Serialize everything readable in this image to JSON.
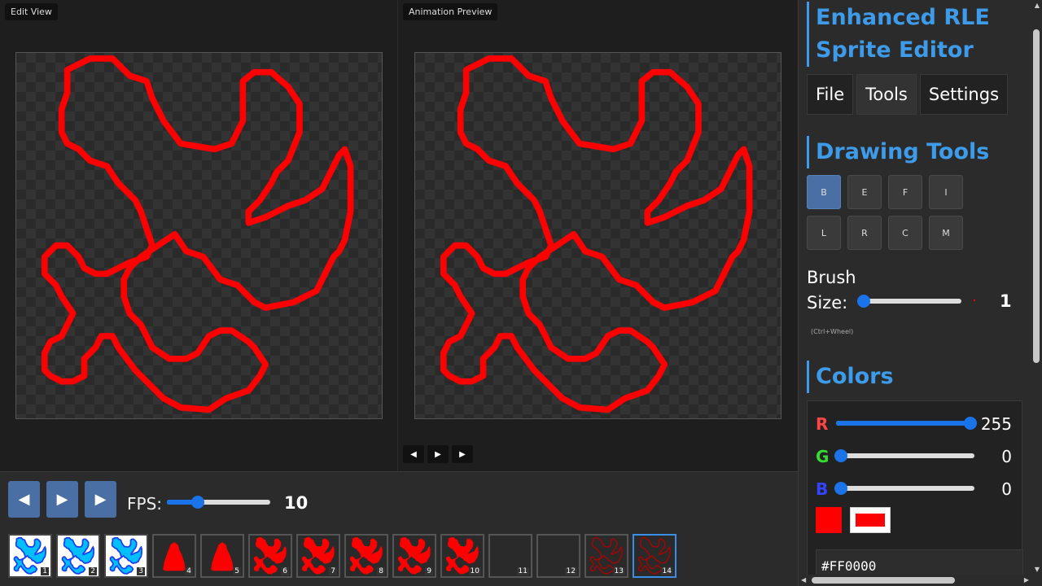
{
  "edit_view": {
    "label": "Edit View"
  },
  "preview": {
    "label": "Animation Preview"
  },
  "preview_controls": {
    "prev_icon": "◀",
    "play_icon": "▶",
    "next_icon": "▶"
  },
  "playback": {
    "prev_icon": "◀",
    "play_icon": "▶",
    "next_icon": "▶",
    "fps_label": "FPS:",
    "fps_value": "10",
    "fps_fraction": 0.3
  },
  "frames": [
    {
      "num": "1",
      "style": "light"
    },
    {
      "num": "2",
      "style": "light"
    },
    {
      "num": "3",
      "style": "light"
    },
    {
      "num": "4",
      "style": "ghost"
    },
    {
      "num": "5",
      "style": "ghost"
    },
    {
      "num": "6",
      "style": "solid"
    },
    {
      "num": "7",
      "style": "solid"
    },
    {
      "num": "8",
      "style": "solid"
    },
    {
      "num": "9",
      "style": "solid"
    },
    {
      "num": "10",
      "style": "solid"
    },
    {
      "num": "11",
      "style": "empty"
    },
    {
      "num": "12",
      "style": "empty"
    },
    {
      "num": "13",
      "style": "outline"
    },
    {
      "num": "14",
      "style": "outline-active"
    }
  ],
  "sidebar": {
    "app_title_line1": "Enhanced RLE",
    "app_title_line2": "Sprite Editor",
    "tabs": [
      {
        "label": "File"
      },
      {
        "label": "Tools"
      },
      {
        "label": "Settings"
      }
    ],
    "drawing_tools_title": "Drawing Tools",
    "tools": [
      {
        "label": "B",
        "active": true
      },
      {
        "label": "E"
      },
      {
        "label": "F"
      },
      {
        "label": "I"
      },
      {
        "label": "L"
      },
      {
        "label": "R"
      },
      {
        "label": "C"
      },
      {
        "label": "M"
      }
    ],
    "brush_label_line1": "Brush",
    "brush_label_line2": "Size:",
    "brush_value": "1",
    "brush_hint": "(Ctrl+Wheel)",
    "colors_title": "Colors",
    "r_label": "R",
    "r_value": "255",
    "g_label": "G",
    "g_value": "0",
    "b_label": "B",
    "b_value": "0",
    "hex_value": "#FF0000"
  },
  "colors": {
    "accent": "#3d9be9",
    "sprite": "#ff0000",
    "button": "#4a6fa5",
    "slider": "#1a73e8"
  }
}
